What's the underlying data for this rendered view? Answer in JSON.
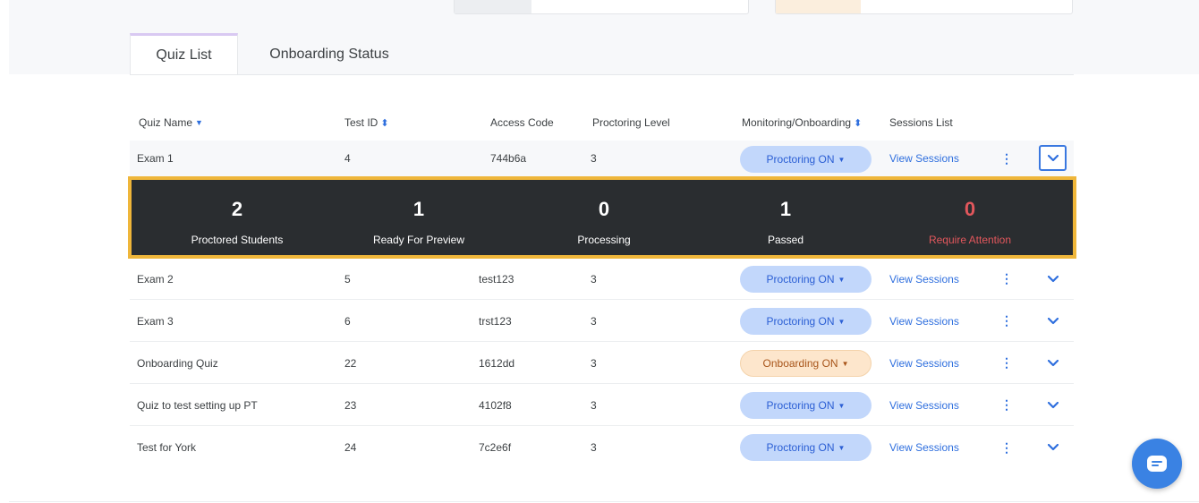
{
  "tabs": [
    {
      "label": "Quiz List",
      "active": true
    },
    {
      "label": "Onboarding Status",
      "active": false
    }
  ],
  "columns": {
    "quiz_name": "Quiz Name",
    "test_id": "Test ID",
    "access_code": "Access Code",
    "proctoring_level": "Proctoring Level",
    "monitoring": "Monitoring/Onboarding",
    "sessions": "Sessions List"
  },
  "stats": {
    "proctored": {
      "value": "2",
      "label": "Proctored Students"
    },
    "ready": {
      "value": "1",
      "label": "Ready For Preview"
    },
    "processing": {
      "value": "0",
      "label": "Processing"
    },
    "passed": {
      "value": "1",
      "label": "Passed"
    },
    "attention": {
      "value": "0",
      "label": "Require Attention"
    }
  },
  "rows": [
    {
      "name": "Exam 1",
      "test_id": "4",
      "access_code": "744b6a",
      "level": "3",
      "status": "Proctoring ON",
      "sessions": "View Sessions"
    },
    {
      "name": "Exam 2",
      "test_id": "5",
      "access_code": "test123",
      "level": "3",
      "status": "Proctoring ON",
      "sessions": "View Sessions"
    },
    {
      "name": "Exam 3",
      "test_id": "6",
      "access_code": "trst123",
      "level": "3",
      "status": "Proctoring ON",
      "sessions": "View Sessions"
    },
    {
      "name": "Onboarding Quiz",
      "test_id": "22",
      "access_code": "1612dd",
      "level": "3",
      "status": "Onboarding ON",
      "sessions": "View Sessions"
    },
    {
      "name": "Quiz to test setting up PT",
      "test_id": "23",
      "access_code": "4102f8",
      "level": "3",
      "status": "Proctoring ON",
      "sessions": "View Sessions"
    },
    {
      "name": "Test for York",
      "test_id": "24",
      "access_code": "7c2e6f",
      "level": "3",
      "status": "Proctoring ON",
      "sessions": "View Sessions"
    }
  ],
  "icons": {
    "sort_desc": "▼",
    "sort_both": "⬍",
    "caret": "▼",
    "kebab": "⋮",
    "chevron": "chevron-down",
    "chat": "chat-bubble"
  },
  "colors": {
    "accent": "#2f6fde",
    "proctoring_pill": "#c2d7fb",
    "onboarding_pill": "#fde6cc",
    "stats_bg": "#2a2d30",
    "stats_border": "#efb63a",
    "attention": "#e2575c"
  }
}
